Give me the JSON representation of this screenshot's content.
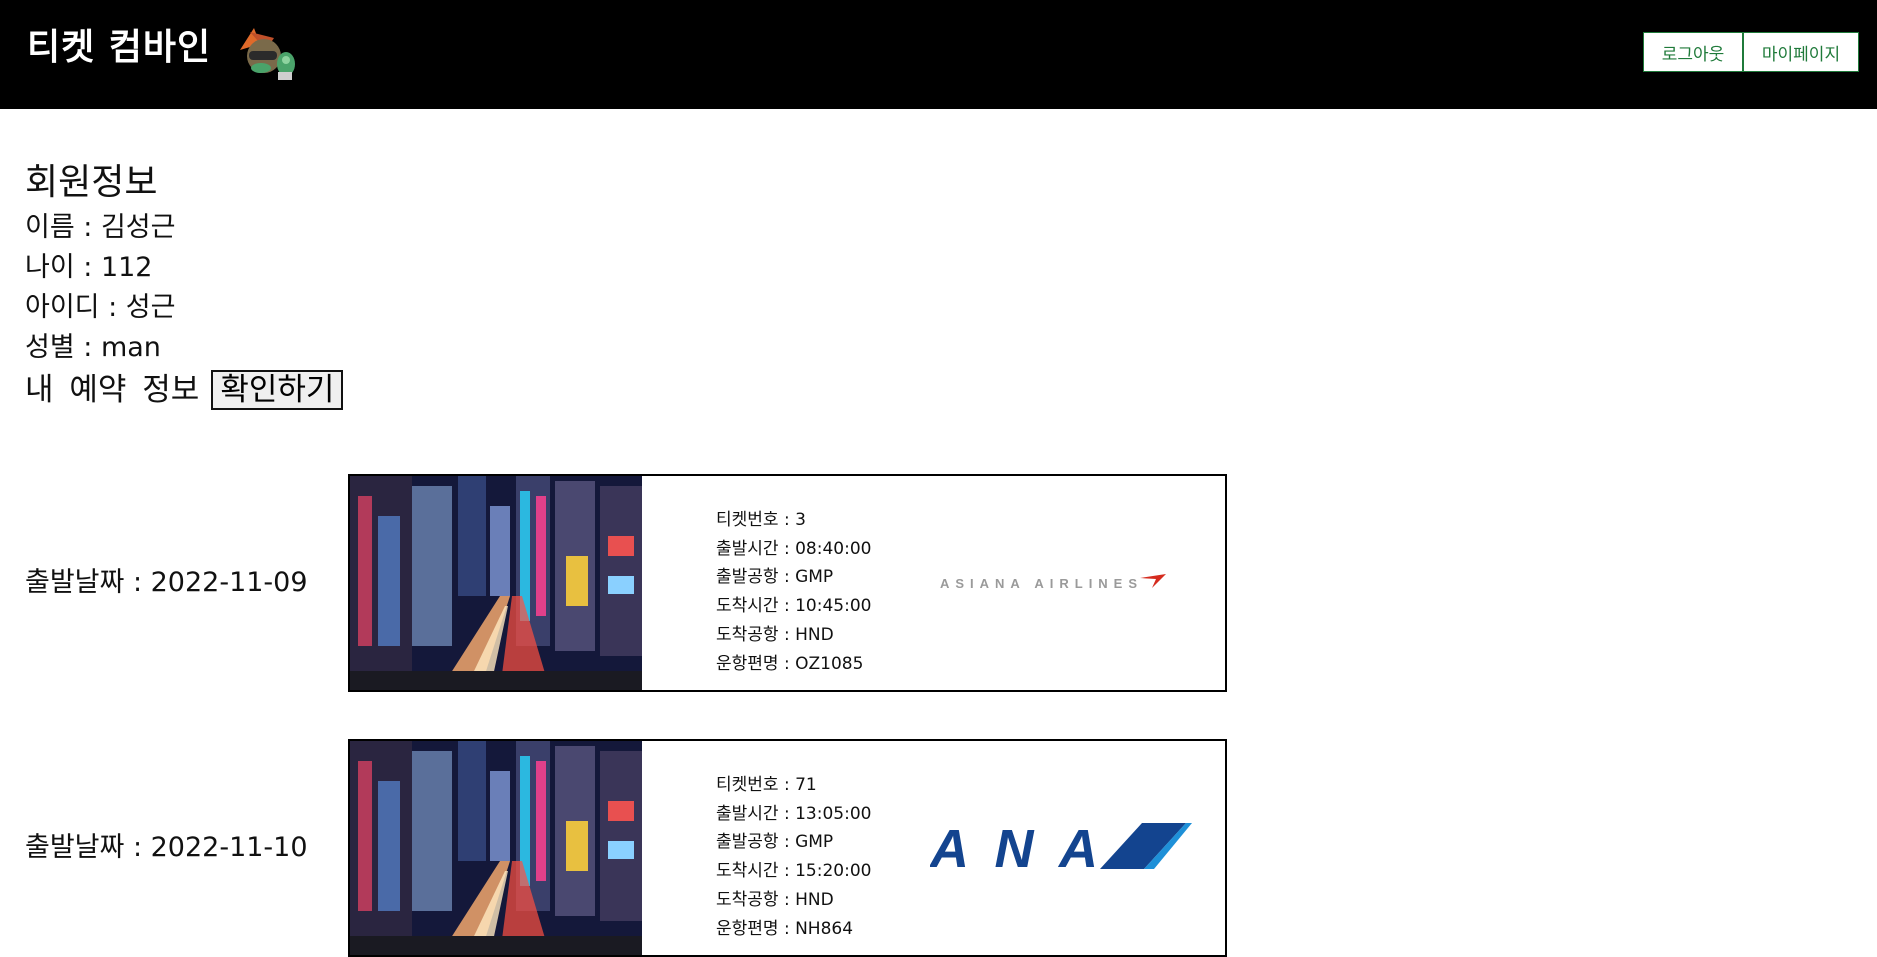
{
  "header": {
    "title": "티켓 컴바인",
    "logout_label": "로그아웃",
    "mypage_label": "마이페이지"
  },
  "member": {
    "title": "회원정보",
    "name": "이름 : 김성근",
    "age": "나이 : 112",
    "id": "아이디 : 성근",
    "gender": "성별 : man",
    "reservation_label": "내 예약 정보",
    "check_button": "확인하기"
  },
  "tickets": [
    {
      "depart_date": "출발날짜 : 2022-11-09",
      "ticket_no": "티켓번호 : 3",
      "depart_time": "출발시간 : 08:40:00",
      "depart_airport": "출발공항 : GMP",
      "arrive_time": "도착시간 : 10:45:00",
      "arrive_airport": "도착공항 : HND",
      "flight_no": "운항편명 : OZ1085",
      "airline_logo_text": "ASIANA AIRLINES"
    },
    {
      "depart_date": "출발날짜 : 2022-11-10",
      "ticket_no": "티켓번호 : 71",
      "depart_time": "출발시간 : 13:05:00",
      "depart_airport": "출발공항 : GMP",
      "arrive_time": "도착시간 : 15:20:00",
      "arrive_airport": "도착공항 : HND",
      "flight_no": "운항편명 : NH864",
      "airline_logo_text": "ANA"
    }
  ],
  "colors": {
    "header_bg": "#000000",
    "button_border": "#1f7a3a",
    "asiana_red": "#d52b1e",
    "ana_blue": "#13448f",
    "ana_light_blue": "#1e90d8"
  },
  "icons": {
    "mascot": "mascot-logo-icon",
    "city": "city-night-photo",
    "asiana": "asiana-airlines-logo",
    "ana": "ana-logo"
  }
}
